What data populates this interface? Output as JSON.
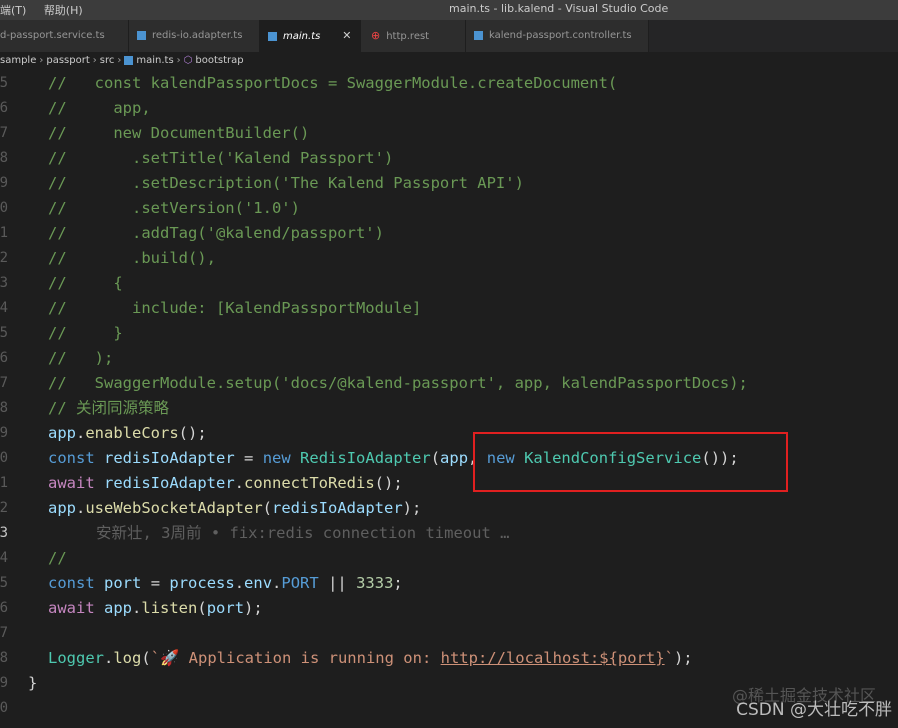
{
  "window": {
    "menu": [
      "端(T)",
      "帮助(H)"
    ],
    "title": "main.ts - lib.kalend - Visual Studio Code"
  },
  "tabs": [
    {
      "label": "d-passport.service.ts",
      "active": false
    },
    {
      "label": "redis-io.adapter.ts",
      "active": false
    },
    {
      "label": "main.ts",
      "active": true
    },
    {
      "label": "http.rest",
      "active": false
    },
    {
      "label": "kalend-passport.controller.ts",
      "active": false
    }
  ],
  "breadcrumb": [
    "sample",
    "passport",
    "src",
    "main.ts",
    "bootstrap"
  ],
  "line_numbers": [
    "5",
    "6",
    "7",
    "8",
    "9",
    "0",
    "1",
    "2",
    "3",
    "4",
    "5",
    "6",
    "7",
    "8",
    "9",
    "0",
    "1",
    "2",
    "3",
    "4",
    "5",
    "6",
    "7",
    "8",
    "9",
    "0",
    "1"
  ],
  "code": {
    "l1": "//   const kalendPassportDocs = SwaggerModule.createDocument(",
    "l2": "//     app,",
    "l3": "//     new DocumentBuilder()",
    "l4": "//       .setTitle('Kalend Passport')",
    "l5": "//       .setDescription('The Kalend Passport API')",
    "l6": "//       .setVersion('1.0')",
    "l7": "//       .addTag('@kalend/passport')",
    "l8": "//       .build(),",
    "l9": "//     {",
    "l10": "//       include: [KalendPassportModule]",
    "l11": "//     }",
    "l12": "//   );",
    "l13": "//   SwaggerModule.setup('docs/@kalend-passport', app, kalendPassportDocs);",
    "l14": "// 关闭同源策略",
    "blame": "安新壮, 3周前 • fix:redis connection timeout …",
    "l19": "//",
    "log_msg": "🚀 Application is running on: ",
    "log_url": "http://localhost:${port}"
  },
  "watermark": "CSDN @大壮吃不胖",
  "watermark_faint": "@稀土掘金技术社区"
}
